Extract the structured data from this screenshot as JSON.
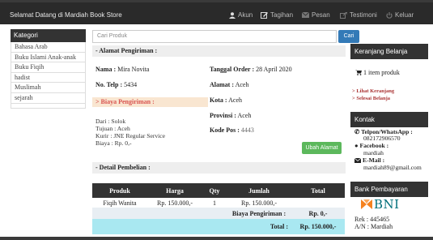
{
  "header": {
    "welcome": "Selamat Datang di Mardiah Book Store",
    "nav": [
      {
        "label": "Akun",
        "icon": "user-icon"
      },
      {
        "label": "Tagihan",
        "icon": "edit-icon"
      },
      {
        "label": "Pesan",
        "icon": "mail-icon"
      },
      {
        "label": "Testimoni",
        "icon": "share-icon"
      },
      {
        "label": "Keluar",
        "icon": "power-icon"
      }
    ]
  },
  "sidebar": {
    "title": "Kategori",
    "items": [
      "Bahasa Arab",
      "Buku Islami Anak-anak",
      "Buku Fiqih",
      "hadist",
      "Muslimah",
      "sejarah"
    ]
  },
  "search": {
    "placeholder": "Cari Produk",
    "button": "Cari"
  },
  "shipping": {
    "section_title": "- Alamat Pengiriman :",
    "nama_label": "Nama :",
    "nama_value": "Mira Novita",
    "telp_label": "No. Telp :",
    "telp_value": "5434",
    "tanggal_label": "Tanggal Order :",
    "tanggal_value": "28 April 2020",
    "alamat_label": "Alamat :",
    "alamat_value": "Aceh",
    "kota_label": "Kota :",
    "kota_value": "Aceh",
    "provinsi_label": "Provinsi :",
    "provinsi_value": "Aceh",
    "kodepos_label": "Kode Pos :",
    "kodepos_value": "4443",
    "biaya_title": "> Biaya Pengiriman :",
    "dari": "Dari : Solok",
    "tujuan": "Tujuan : Aceh",
    "kurir": "Kurir : JNE Regular Service",
    "biaya": "Biaya : Rp. 0,-",
    "ubah_button": "Ubah Alamat"
  },
  "detail": {
    "section_title": "- Detail Pembelian :",
    "columns": [
      "Produk",
      "Harga",
      "Qty",
      "Jumlah",
      "Total"
    ],
    "rows": [
      {
        "produk": "Fiqih Wanita",
        "harga": "Rp. 150.000,-",
        "qty": "1",
        "jumlah": "Rp. 150.000,-",
        "total": ""
      }
    ],
    "biaya_label": "Biaya Pengiriman :",
    "biaya_value": "Rp. 0,-",
    "total_label": "Total :",
    "total_value": "Rp. 150.000,-"
  },
  "cart": {
    "title": "Keranjang Belanja",
    "count": "1 item produk",
    "links": [
      "> Lihat Keranjang",
      "> Selesai Belanja"
    ]
  },
  "contact": {
    "title": "Kontak",
    "phone_label": "Telpon/WhatsApp :",
    "phone": "082172906570",
    "fb_label": "Facebook :",
    "fb": "mardiah",
    "email_label": "E-Mail :",
    "email": "mardiah89@gmail.com"
  },
  "bank": {
    "title": "Bank Pembayaran",
    "logo_text": "BNI",
    "rek": "Rek : 445465",
    "an": "A/N : Mardiah"
  },
  "colors": {
    "topbar": "#2a2a2a",
    "accent_blue": "#337ab7",
    "green": "#5cb85c",
    "red": "#d9534f",
    "cyan_row": "#a9e8f1",
    "bni_orange": "#f58220",
    "bni_teal": "#006f7a"
  }
}
